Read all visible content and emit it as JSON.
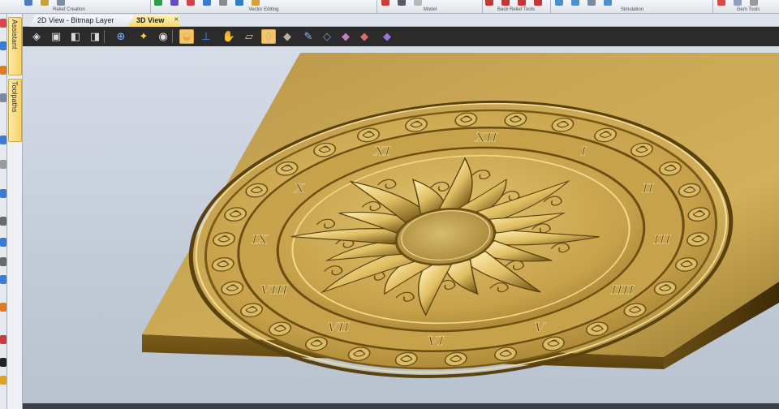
{
  "ribbon": {
    "groups": [
      {
        "label": "Relief Creation",
        "colors": [
          "#4a7ec4",
          "#c6a23b",
          "#7d8ca0"
        ]
      },
      {
        "label": "Vector Editing",
        "colors": [
          "#2f9e44",
          "#6c4cc2",
          "#d04545",
          "#3b7ad6",
          "#8a8a8a",
          "#2c80c9",
          "#d7a13b"
        ]
      },
      {
        "label": "Model",
        "colors": [
          "#d03b3b",
          "#555c66",
          "#b8b8b8"
        ]
      },
      {
        "label": "Back Relief Tools",
        "colors": [
          "#c23838",
          "#c23838",
          "#c23838",
          "#c23838"
        ]
      },
      {
        "label": "Simulation",
        "colors": [
          "#4c8fd1",
          "#4c8fd1",
          "#7a8aa0",
          "#4c8fd1"
        ]
      },
      {
        "label": "Gem Tools",
        "colors": [
          "#d84b4b",
          "#8aa1c0",
          "#9a9a9a"
        ]
      }
    ]
  },
  "side_panels": {
    "assistant_label": "Assistant",
    "toolpaths_label": "Toolpaths"
  },
  "tabs": {
    "view_2d_label": "2D View - Bitmap Layer",
    "view_3d_label": "3D View",
    "close_glyph": "×"
  },
  "view_toolbar": {
    "buttons": [
      {
        "name": "iso-view-icon",
        "glyph": "◈",
        "color": "#d9d9d9"
      },
      {
        "name": "top-view-icon",
        "glyph": "▣",
        "color": "#d9d9d9"
      },
      {
        "name": "front-view-icon",
        "glyph": "◧",
        "color": "#d9d9d9"
      },
      {
        "name": "right-view-icon",
        "glyph": "◨",
        "color": "#d9d9d9"
      },
      {
        "name": "zoom-icon",
        "glyph": "⊕",
        "color": "#7fb3ff"
      },
      {
        "name": "light-icon",
        "glyph": "✦",
        "color": "#ffd24a"
      },
      {
        "name": "eye-icon",
        "glyph": "◉",
        "color": "#e0e0e0"
      },
      {
        "name": "shaded-relief-icon",
        "glyph": "◒",
        "color": "#e8a83a"
      },
      {
        "name": "axes-icon",
        "glyph": "⊥",
        "color": "#4a90ff"
      },
      {
        "name": "hand-icon",
        "glyph": "✋",
        "color": "#e8a83a"
      },
      {
        "name": "material-icon",
        "glyph": "▱",
        "color": "#d8c08a"
      },
      {
        "name": "plane-icon",
        "glyph": "◊",
        "color": "#c2b080"
      },
      {
        "name": "block-icon",
        "glyph": "◆",
        "color": "#b9b09c"
      },
      {
        "name": "brush-icon",
        "glyph": "✎",
        "color": "#8fb6ff"
      },
      {
        "name": "layer-icon",
        "glyph": "◇",
        "color": "#6fa0d0"
      },
      {
        "name": "relief-layer-icon",
        "glyph": "◆",
        "color": "#c77cc0"
      },
      {
        "name": "relief-colour-icon",
        "glyph": "◆",
        "color": "#e06a6a"
      },
      {
        "name": "wireframe-icon",
        "glyph": "◆",
        "color": "#9a73e0"
      }
    ]
  },
  "relief": {
    "outer_numerals": [
      "XII",
      "I",
      "II",
      "III",
      "IIII",
      "V",
      "VI",
      "VII",
      "VIII",
      "IX",
      "X",
      "XI"
    ],
    "colors": {
      "gold_light": "#f1d98e",
      "gold_mid": "#c8a64a",
      "gold_dark": "#7a5c18",
      "gold_shadow": "#4a3508"
    }
  }
}
